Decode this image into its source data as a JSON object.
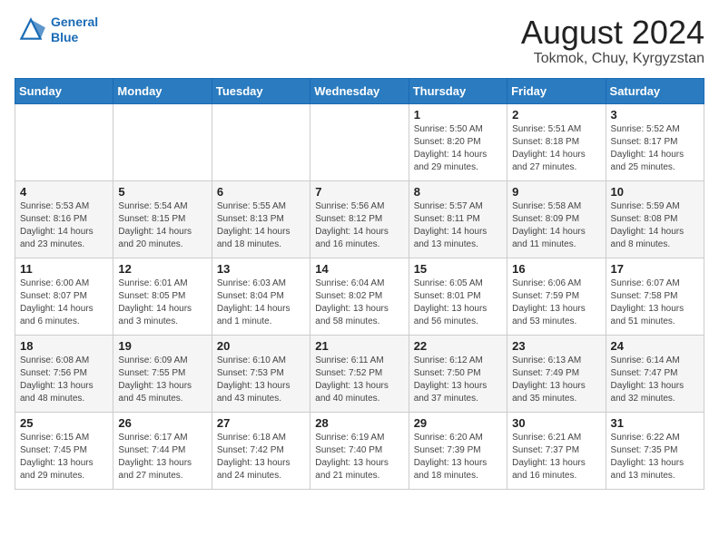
{
  "header": {
    "logo_line1": "General",
    "logo_line2": "Blue",
    "month_title": "August 2024",
    "location": "Tokmok, Chuy, Kyrgyzstan"
  },
  "weekdays": [
    "Sunday",
    "Monday",
    "Tuesday",
    "Wednesday",
    "Thursday",
    "Friday",
    "Saturday"
  ],
  "weeks": [
    [
      {
        "day": "",
        "info": ""
      },
      {
        "day": "",
        "info": ""
      },
      {
        "day": "",
        "info": ""
      },
      {
        "day": "",
        "info": ""
      },
      {
        "day": "1",
        "info": "Sunrise: 5:50 AM\nSunset: 8:20 PM\nDaylight: 14 hours\nand 29 minutes."
      },
      {
        "day": "2",
        "info": "Sunrise: 5:51 AM\nSunset: 8:18 PM\nDaylight: 14 hours\nand 27 minutes."
      },
      {
        "day": "3",
        "info": "Sunrise: 5:52 AM\nSunset: 8:17 PM\nDaylight: 14 hours\nand 25 minutes."
      }
    ],
    [
      {
        "day": "4",
        "info": "Sunrise: 5:53 AM\nSunset: 8:16 PM\nDaylight: 14 hours\nand 23 minutes."
      },
      {
        "day": "5",
        "info": "Sunrise: 5:54 AM\nSunset: 8:15 PM\nDaylight: 14 hours\nand 20 minutes."
      },
      {
        "day": "6",
        "info": "Sunrise: 5:55 AM\nSunset: 8:13 PM\nDaylight: 14 hours\nand 18 minutes."
      },
      {
        "day": "7",
        "info": "Sunrise: 5:56 AM\nSunset: 8:12 PM\nDaylight: 14 hours\nand 16 minutes."
      },
      {
        "day": "8",
        "info": "Sunrise: 5:57 AM\nSunset: 8:11 PM\nDaylight: 14 hours\nand 13 minutes."
      },
      {
        "day": "9",
        "info": "Sunrise: 5:58 AM\nSunset: 8:09 PM\nDaylight: 14 hours\nand 11 minutes."
      },
      {
        "day": "10",
        "info": "Sunrise: 5:59 AM\nSunset: 8:08 PM\nDaylight: 14 hours\nand 8 minutes."
      }
    ],
    [
      {
        "day": "11",
        "info": "Sunrise: 6:00 AM\nSunset: 8:07 PM\nDaylight: 14 hours\nand 6 minutes."
      },
      {
        "day": "12",
        "info": "Sunrise: 6:01 AM\nSunset: 8:05 PM\nDaylight: 14 hours\nand 3 minutes."
      },
      {
        "day": "13",
        "info": "Sunrise: 6:03 AM\nSunset: 8:04 PM\nDaylight: 14 hours\nand 1 minute."
      },
      {
        "day": "14",
        "info": "Sunrise: 6:04 AM\nSunset: 8:02 PM\nDaylight: 13 hours\nand 58 minutes."
      },
      {
        "day": "15",
        "info": "Sunrise: 6:05 AM\nSunset: 8:01 PM\nDaylight: 13 hours\nand 56 minutes."
      },
      {
        "day": "16",
        "info": "Sunrise: 6:06 AM\nSunset: 7:59 PM\nDaylight: 13 hours\nand 53 minutes."
      },
      {
        "day": "17",
        "info": "Sunrise: 6:07 AM\nSunset: 7:58 PM\nDaylight: 13 hours\nand 51 minutes."
      }
    ],
    [
      {
        "day": "18",
        "info": "Sunrise: 6:08 AM\nSunset: 7:56 PM\nDaylight: 13 hours\nand 48 minutes."
      },
      {
        "day": "19",
        "info": "Sunrise: 6:09 AM\nSunset: 7:55 PM\nDaylight: 13 hours\nand 45 minutes."
      },
      {
        "day": "20",
        "info": "Sunrise: 6:10 AM\nSunset: 7:53 PM\nDaylight: 13 hours\nand 43 minutes."
      },
      {
        "day": "21",
        "info": "Sunrise: 6:11 AM\nSunset: 7:52 PM\nDaylight: 13 hours\nand 40 minutes."
      },
      {
        "day": "22",
        "info": "Sunrise: 6:12 AM\nSunset: 7:50 PM\nDaylight: 13 hours\nand 37 minutes."
      },
      {
        "day": "23",
        "info": "Sunrise: 6:13 AM\nSunset: 7:49 PM\nDaylight: 13 hours\nand 35 minutes."
      },
      {
        "day": "24",
        "info": "Sunrise: 6:14 AM\nSunset: 7:47 PM\nDaylight: 13 hours\nand 32 minutes."
      }
    ],
    [
      {
        "day": "25",
        "info": "Sunrise: 6:15 AM\nSunset: 7:45 PM\nDaylight: 13 hours\nand 29 minutes."
      },
      {
        "day": "26",
        "info": "Sunrise: 6:17 AM\nSunset: 7:44 PM\nDaylight: 13 hours\nand 27 minutes."
      },
      {
        "day": "27",
        "info": "Sunrise: 6:18 AM\nSunset: 7:42 PM\nDaylight: 13 hours\nand 24 minutes."
      },
      {
        "day": "28",
        "info": "Sunrise: 6:19 AM\nSunset: 7:40 PM\nDaylight: 13 hours\nand 21 minutes."
      },
      {
        "day": "29",
        "info": "Sunrise: 6:20 AM\nSunset: 7:39 PM\nDaylight: 13 hours\nand 18 minutes."
      },
      {
        "day": "30",
        "info": "Sunrise: 6:21 AM\nSunset: 7:37 PM\nDaylight: 13 hours\nand 16 minutes."
      },
      {
        "day": "31",
        "info": "Sunrise: 6:22 AM\nSunset: 7:35 PM\nDaylight: 13 hours\nand 13 minutes."
      }
    ]
  ]
}
